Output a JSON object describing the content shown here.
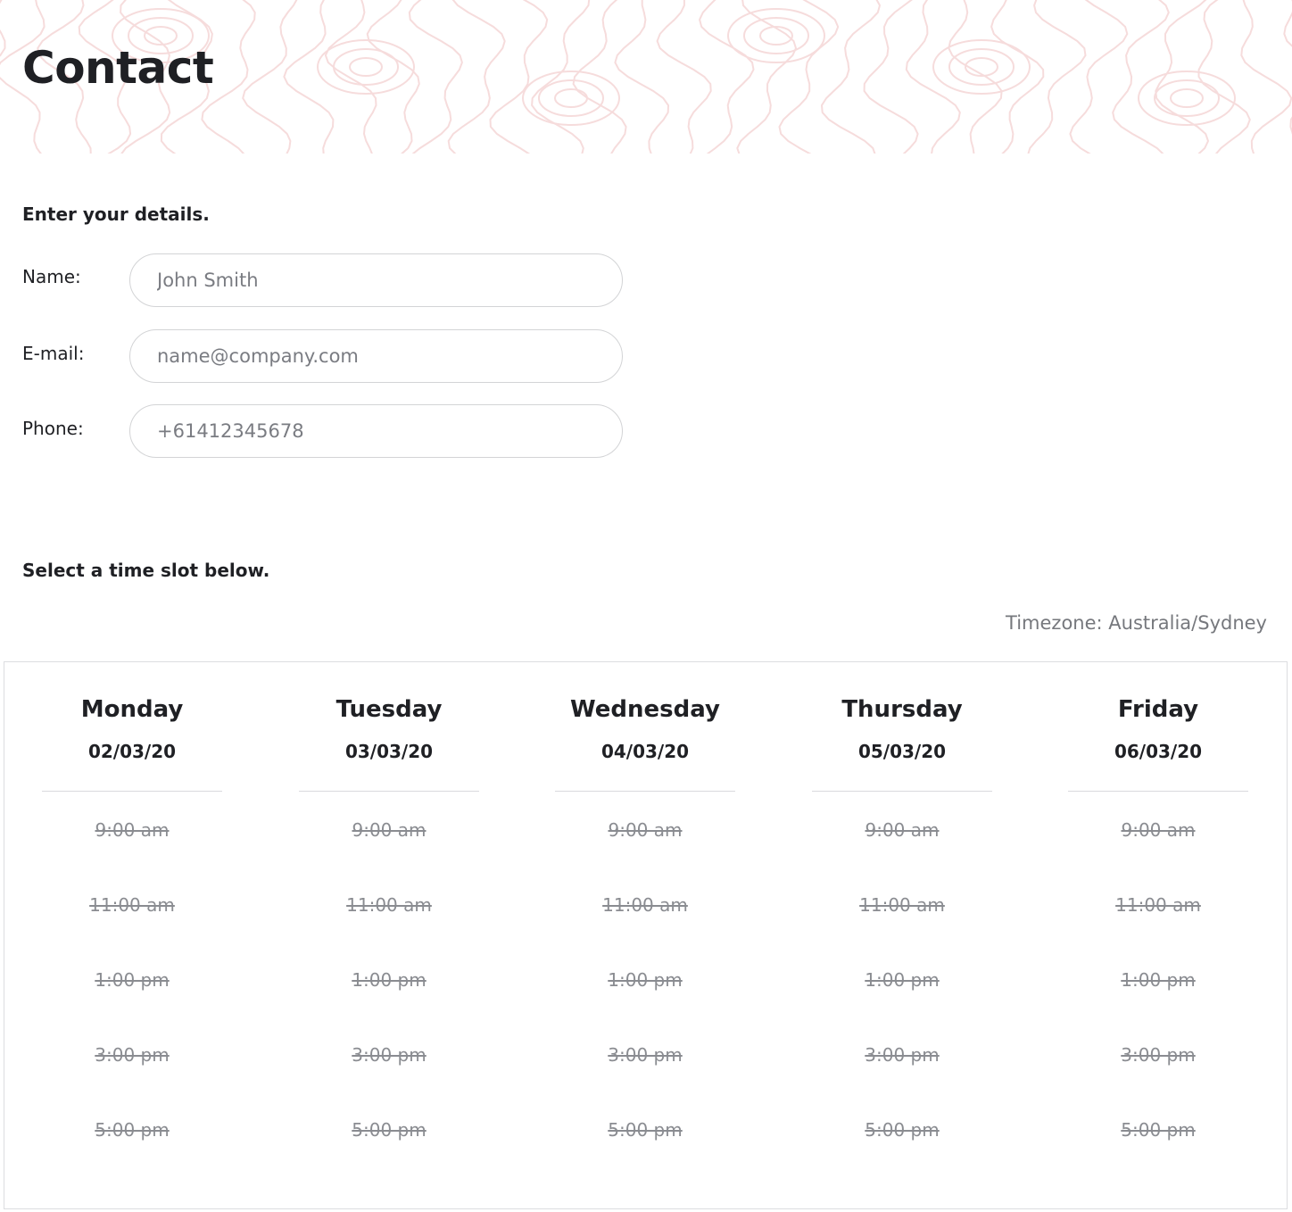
{
  "header": {
    "title": "Contact",
    "pattern_color": "#f6dcdc"
  },
  "details": {
    "heading": "Enter your details.",
    "name": {
      "label": "Name:",
      "placeholder": "John Smith"
    },
    "email": {
      "label": "E-mail:",
      "placeholder": "name@company.com"
    },
    "phone": {
      "label": "Phone:",
      "placeholder": "+61412345678"
    }
  },
  "schedule": {
    "heading": "Select a time slot below.",
    "timezone": "Timezone: Australia/Sydney",
    "slot_status": "unavailable",
    "days": [
      {
        "name": "Monday",
        "date": "02/03/20",
        "slots": [
          "9:00 am",
          "11:00 am",
          "1:00 pm",
          "3:00 pm",
          "5:00 pm"
        ]
      },
      {
        "name": "Tuesday",
        "date": "03/03/20",
        "slots": [
          "9:00 am",
          "11:00 am",
          "1:00 pm",
          "3:00 pm",
          "5:00 pm"
        ]
      },
      {
        "name": "Wednesday",
        "date": "04/03/20",
        "slots": [
          "9:00 am",
          "11:00 am",
          "1:00 pm",
          "3:00 pm",
          "5:00 pm"
        ]
      },
      {
        "name": "Thursday",
        "date": "05/03/20",
        "slots": [
          "9:00 am",
          "11:00 am",
          "1:00 pm",
          "3:00 pm",
          "5:00 pm"
        ]
      },
      {
        "name": "Friday",
        "date": "06/03/20",
        "slots": [
          "9:00 am",
          "11:00 am",
          "1:00 pm",
          "3:00 pm",
          "5:00 pm"
        ]
      }
    ]
  }
}
